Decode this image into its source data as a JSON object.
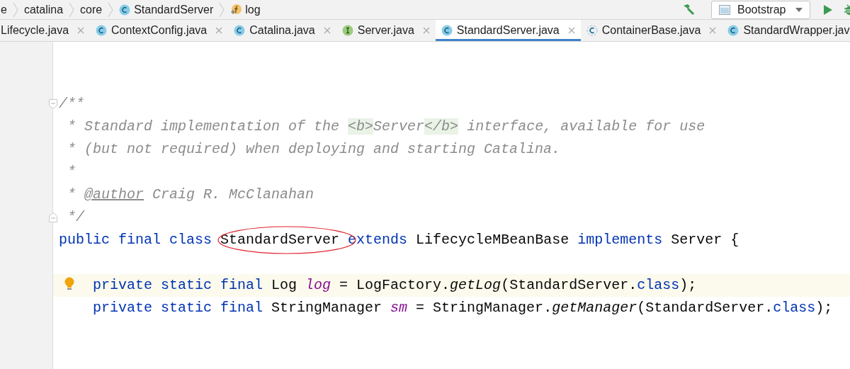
{
  "breadcrumb": [
    {
      "label": "e",
      "kind": "text"
    },
    {
      "label": "catalina",
      "kind": "text"
    },
    {
      "label": "core",
      "kind": "text"
    },
    {
      "label": "StandardServer",
      "kind": "class"
    },
    {
      "label": "log",
      "kind": "field"
    }
  ],
  "run_config": {
    "label": "Bootstrap"
  },
  "tabs": [
    {
      "label": "Lifecycle.java",
      "kind": "cut",
      "selected": false
    },
    {
      "label": "ContextConfig.java",
      "kind": "class",
      "selected": false
    },
    {
      "label": "Catalina.java",
      "kind": "class",
      "selected": false
    },
    {
      "label": "Server.java",
      "kind": "interface",
      "selected": false
    },
    {
      "label": "StandardServer.java",
      "kind": "class",
      "selected": true
    },
    {
      "label": "ContainerBase.java",
      "kind": "abstract",
      "selected": false
    },
    {
      "label": "StandardWrapper.jav",
      "kind": "class",
      "selected": false
    }
  ],
  "lines": [
    {
      "kind": "code",
      "fold_start": true,
      "tokens": [
        {
          "kind": "cmt",
          "text": "/**"
        }
      ]
    },
    {
      "kind": "code",
      "tokens": [
        {
          "kind": "cmt",
          "text": " * Standard implementation of the "
        },
        {
          "kind": "tag",
          "text": "<b>"
        },
        {
          "kind": "cmt",
          "text": "Server"
        },
        {
          "kind": "tag",
          "text": "</b>"
        },
        {
          "kind": "cmt",
          "text": " interface, available for use"
        }
      ]
    },
    {
      "kind": "code",
      "tokens": [
        {
          "kind": "cmt",
          "text": " * (but not required) when deploying and starting Catalina."
        }
      ]
    },
    {
      "kind": "code",
      "tokens": [
        {
          "kind": "cmt",
          "text": " *"
        }
      ]
    },
    {
      "kind": "code",
      "tokens": [
        {
          "kind": "cmt",
          "text": " * "
        },
        {
          "kind": "author",
          "text": "@author"
        },
        {
          "kind": "cmt",
          "text": " Craig R. McClanahan"
        }
      ]
    },
    {
      "kind": "code",
      "fold_end": true,
      "tokens": [
        {
          "kind": "cmt",
          "text": " */"
        }
      ]
    },
    {
      "kind": "code",
      "tokens": [
        {
          "kind": "kw",
          "text": "public final class "
        },
        {
          "kind": "plain",
          "text": "StandardServer",
          "circled": true
        },
        {
          "kind": "kw",
          "text": " extends "
        },
        {
          "kind": "plain",
          "text": "LifecycleMBeanBase "
        },
        {
          "kind": "kw",
          "text": "implements "
        },
        {
          "kind": "plain",
          "text": "Server {"
        }
      ],
      "children": [
        {
          "kind": "blank"
        },
        {
          "kind": "code",
          "current": true,
          "bulb": true,
          "tokens": [
            {
              "kind": "kw",
              "text": "private static final "
            },
            {
              "kind": "plain",
              "text": "Log "
            },
            {
              "kind": "field",
              "text": "log"
            },
            {
              "kind": "plain",
              "text": " = LogFactory."
            },
            {
              "kind": "call",
              "text": "getLog"
            },
            {
              "kind": "plain",
              "text": "(StandardServer."
            },
            {
              "kind": "kw",
              "text": "class"
            },
            {
              "kind": "plain",
              "text": ");"
            }
          ]
        },
        {
          "kind": "code",
          "tokens": [
            {
              "kind": "kw",
              "text": "private static final "
            },
            {
              "kind": "plain",
              "text": "StringManager "
            },
            {
              "kind": "field",
              "text": "sm"
            },
            {
              "kind": "plain",
              "text": " = StringManager."
            },
            {
              "kind": "call",
              "text": "getManager"
            },
            {
              "kind": "plain",
              "text": "(StandardServer."
            },
            {
              "kind": "kw",
              "text": "class"
            },
            {
              "kind": "plain",
              "text": ");"
            }
          ]
        }
      ]
    }
  ]
}
